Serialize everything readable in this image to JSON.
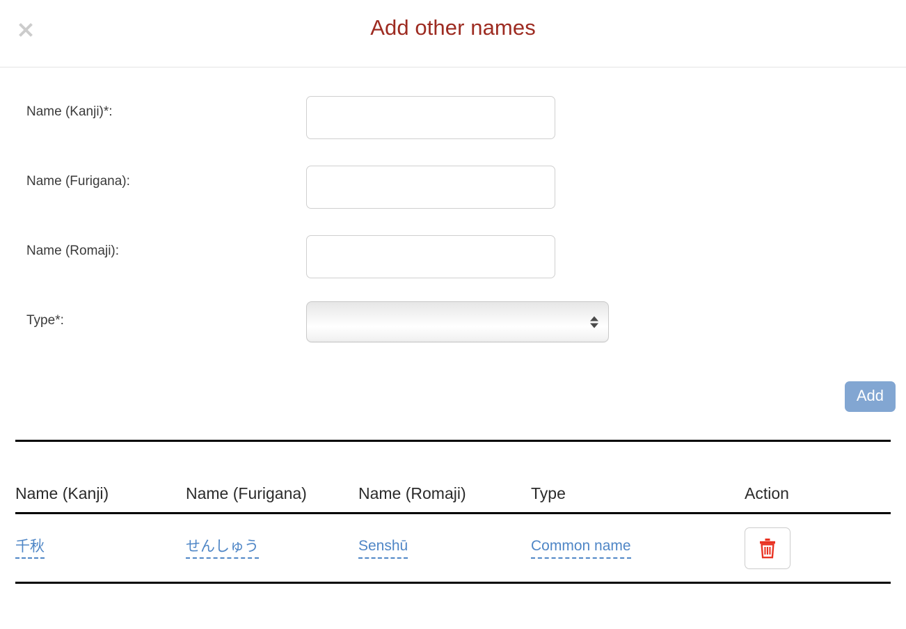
{
  "modal": {
    "title": "Add other names",
    "close_icon": "close-icon"
  },
  "form": {
    "fields": [
      {
        "label": "Name (Kanji)*:",
        "value": "",
        "placeholder": ""
      },
      {
        "label": "Name (Furigana):",
        "value": "",
        "placeholder": ""
      },
      {
        "label": "Name (Romaji):",
        "value": "",
        "placeholder": ""
      }
    ],
    "type_field": {
      "label": "Type*:",
      "selected": "",
      "options": []
    },
    "add_button": "Add"
  },
  "table": {
    "headers": [
      "Name (Kanji)",
      "Name (Furigana)",
      "Name (Romaji)",
      "Type",
      "Action"
    ],
    "rows": [
      {
        "kanji": "千秋",
        "furigana": "せんしゅう",
        "romaji": "Senshū",
        "type": "Common name",
        "action_icon": "trash-icon"
      }
    ]
  },
  "colors": {
    "title": "#9d2b21",
    "add_button": "#82a6d2",
    "cell_link": "#4f86c6",
    "trash_icon": "#e93323",
    "rule": "#000000"
  }
}
